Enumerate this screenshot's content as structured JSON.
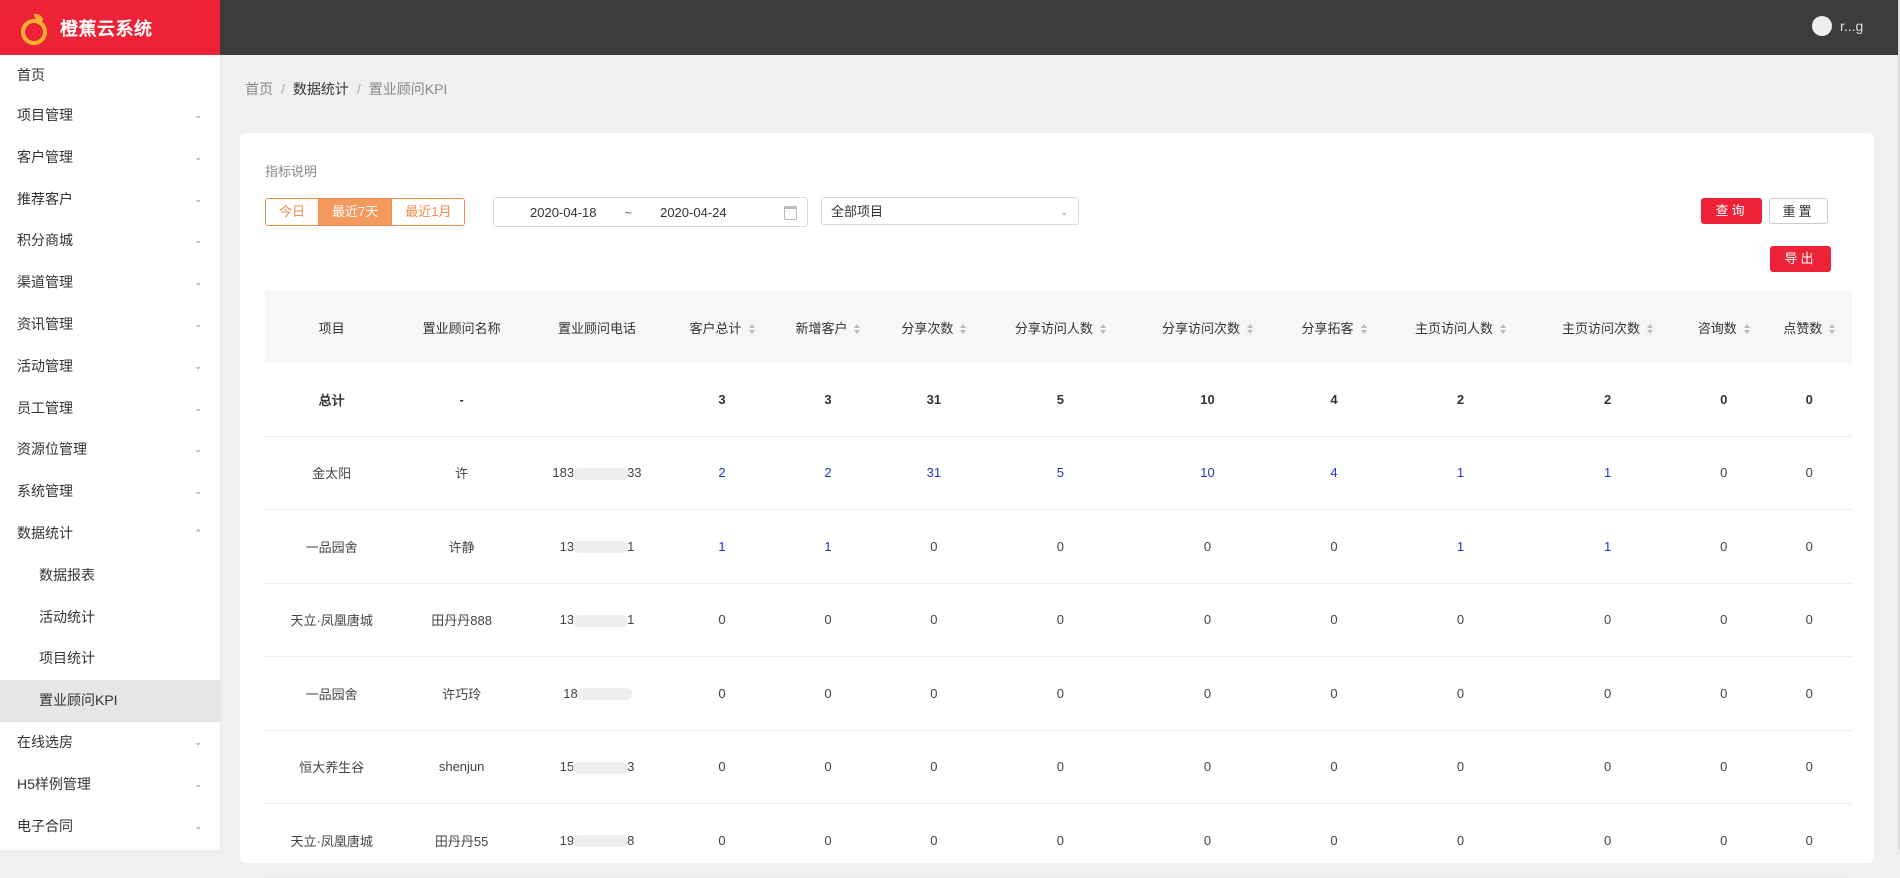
{
  "app": {
    "title": "橙蕉云系统"
  },
  "user": {
    "name": "r...g"
  },
  "sidebar": {
    "items": [
      {
        "label": "首页",
        "chev": false
      },
      {
        "label": "项目管理",
        "chev": true
      },
      {
        "label": "客户管理",
        "chev": true
      },
      {
        "label": "推荐客户",
        "chev": true
      },
      {
        "label": "积分商城",
        "chev": true
      },
      {
        "label": "渠道管理",
        "chev": true
      },
      {
        "label": "资讯管理",
        "chev": true
      },
      {
        "label": "活动管理",
        "chev": true
      },
      {
        "label": "员工管理",
        "chev": true
      },
      {
        "label": "资源位管理",
        "chev": true
      },
      {
        "label": "系统管理",
        "chev": true
      },
      {
        "label": "数据统计",
        "chev": true,
        "open": true
      },
      {
        "label": "数据报表",
        "sub": true
      },
      {
        "label": "活动统计",
        "sub": true
      },
      {
        "label": "项目统计",
        "sub": true
      },
      {
        "label": "置业顾问KPI",
        "sub": true,
        "active": true
      },
      {
        "label": "在线选房",
        "chev": true
      },
      {
        "label": "H5样例管理",
        "chev": true
      },
      {
        "label": "电子合同",
        "chev": true
      }
    ]
  },
  "breadcrumb": {
    "home": "首页",
    "section": "数据统计",
    "current": "置业顾问KPI",
    "sep": "/"
  },
  "filters": {
    "desc": "指标说明",
    "ranges": [
      "今日",
      "最近7天",
      "最近1月"
    ],
    "active_range": 1,
    "date_start": "2020-04-18",
    "date_sep": "~",
    "date_end": "2020-04-24",
    "project_select": "全部项目",
    "query_label": "查询",
    "reset_label": "重置",
    "export_label": "导出"
  },
  "table": {
    "columns": [
      {
        "label": "项目",
        "sortable": false
      },
      {
        "label": "置业顾问名称",
        "sortable": false
      },
      {
        "label": "置业顾问电话",
        "sortable": false
      },
      {
        "label": "客户总计",
        "sortable": true
      },
      {
        "label": "新增客户",
        "sortable": true
      },
      {
        "label": "分享次数",
        "sortable": true
      },
      {
        "label": "分享访问人数",
        "sortable": true
      },
      {
        "label": "分享访问次数",
        "sortable": true
      },
      {
        "label": "分享拓客",
        "sortable": true
      },
      {
        "label": "主页访问人数",
        "sortable": true
      },
      {
        "label": "主页访问次数",
        "sortable": true
      },
      {
        "label": "咨询数",
        "sortable": true
      },
      {
        "label": "点赞数",
        "sortable": true
      }
    ],
    "total": [
      "总计",
      "-",
      "",
      "3",
      "3",
      "31",
      "5",
      "10",
      "4",
      "2",
      "2",
      "0",
      "0"
    ],
    "rows": [
      {
        "cells": [
          "金太阳",
          "许",
          "183",
          "2",
          "2",
          "31",
          "5",
          "10",
          "4",
          "1",
          "1",
          "0",
          "0"
        ],
        "phone_tail": "33",
        "links": [
          3,
          4,
          5,
          6,
          7,
          8,
          9,
          10
        ]
      },
      {
        "cells": [
          "一品园舍",
          "许静",
          "13",
          "1",
          "1",
          "0",
          "0",
          "0",
          "0",
          "1",
          "1",
          "0",
          "0"
        ],
        "phone_tail": "1",
        "links": [
          3,
          4,
          9,
          10
        ]
      },
      {
        "cells": [
          "天立·凤凰唐城",
          "田丹丹888",
          "13",
          "0",
          "0",
          "0",
          "0",
          "0",
          "0",
          "0",
          "0",
          "0",
          "0"
        ],
        "phone_tail": "1",
        "links": []
      },
      {
        "cells": [
          "一品园舍",
          "许巧玲",
          "18",
          "0",
          "0",
          "0",
          "0",
          "0",
          "0",
          "0",
          "0",
          "0",
          "0"
        ],
        "phone_tail": "",
        "links": []
      },
      {
        "cells": [
          "恒大养生谷",
          "shenjun",
          "15",
          "0",
          "0",
          "0",
          "0",
          "0",
          "0",
          "0",
          "0",
          "0",
          "0"
        ],
        "phone_tail": "3",
        "links": []
      },
      {
        "cells": [
          "天立·凤凰唐城",
          "田丹丹55",
          "19",
          "0",
          "0",
          "0",
          "0",
          "0",
          "0",
          "0",
          "0",
          "0",
          "0"
        ],
        "phone_tail": "8",
        "links": []
      }
    ]
  },
  "colors": {
    "brand": "#ee2236",
    "accent": "#f59a5e",
    "link": "#2233cc"
  }
}
